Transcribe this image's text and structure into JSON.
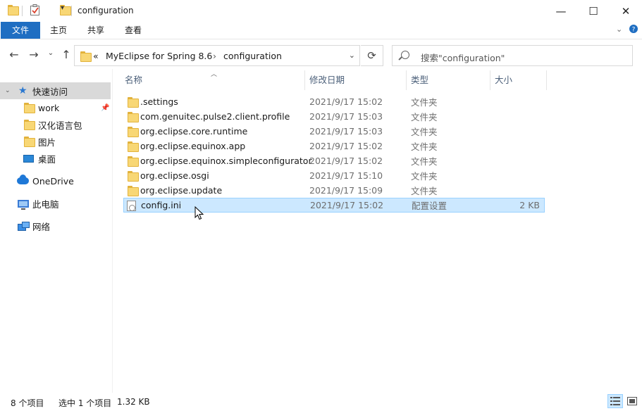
{
  "window": {
    "title": "configuration",
    "minimize_glyph": "—",
    "maximize_glyph": "☐",
    "close_glyph": "✕"
  },
  "ribbon": {
    "tabs": [
      "文件",
      "主页",
      "共享",
      "查看"
    ]
  },
  "address": {
    "overflow": "«",
    "crumbs": [
      "MyEclipse for Spring 8.6",
      "configuration"
    ],
    "separator": "›"
  },
  "search": {
    "placeholder": "搜索\"configuration\""
  },
  "nav": {
    "items": [
      {
        "label": "快速访问",
        "icon": "star-icon",
        "selected": true
      },
      {
        "label": "work",
        "icon": "folder-icon",
        "pinned": true
      },
      {
        "label": "汉化语言包",
        "icon": "folder-icon"
      },
      {
        "label": "图片",
        "icon": "folder-icon"
      },
      {
        "label": "桌面",
        "icon": "desktop-icon"
      },
      {
        "label": "OneDrive",
        "icon": "cloud-icon"
      },
      {
        "label": "此电脑",
        "icon": "computer-icon"
      },
      {
        "label": "网络",
        "icon": "network-icon"
      }
    ]
  },
  "columns": {
    "name": "名称",
    "date": "修改日期",
    "type": "类型",
    "size": "大小"
  },
  "files": [
    {
      "name": ".settings",
      "date": "2021/9/17 15:02",
      "type": "文件夹",
      "size": "",
      "kind": "folder"
    },
    {
      "name": "com.genuitec.pulse2.client.profile",
      "date": "2021/9/17 15:03",
      "type": "文件夹",
      "size": "",
      "kind": "folder"
    },
    {
      "name": "org.eclipse.core.runtime",
      "date": "2021/9/17 15:03",
      "type": "文件夹",
      "size": "",
      "kind": "folder"
    },
    {
      "name": "org.eclipse.equinox.app",
      "date": "2021/9/17 15:02",
      "type": "文件夹",
      "size": "",
      "kind": "folder"
    },
    {
      "name": "org.eclipse.equinox.simpleconfigurator",
      "date": "2021/9/17 15:02",
      "type": "文件夹",
      "size": "",
      "kind": "folder"
    },
    {
      "name": "org.eclipse.osgi",
      "date": "2021/9/17 15:10",
      "type": "文件夹",
      "size": "",
      "kind": "folder"
    },
    {
      "name": "org.eclipse.update",
      "date": "2021/9/17 15:09",
      "type": "文件夹",
      "size": "",
      "kind": "folder"
    },
    {
      "name": "config.ini",
      "date": "2021/9/17 15:02",
      "type": "配置设置",
      "size": "2 KB",
      "kind": "ini",
      "selected": true
    }
  ],
  "status": {
    "count": "8 个项目",
    "selected": "选中 1 个项目",
    "size": "1.32 KB"
  }
}
